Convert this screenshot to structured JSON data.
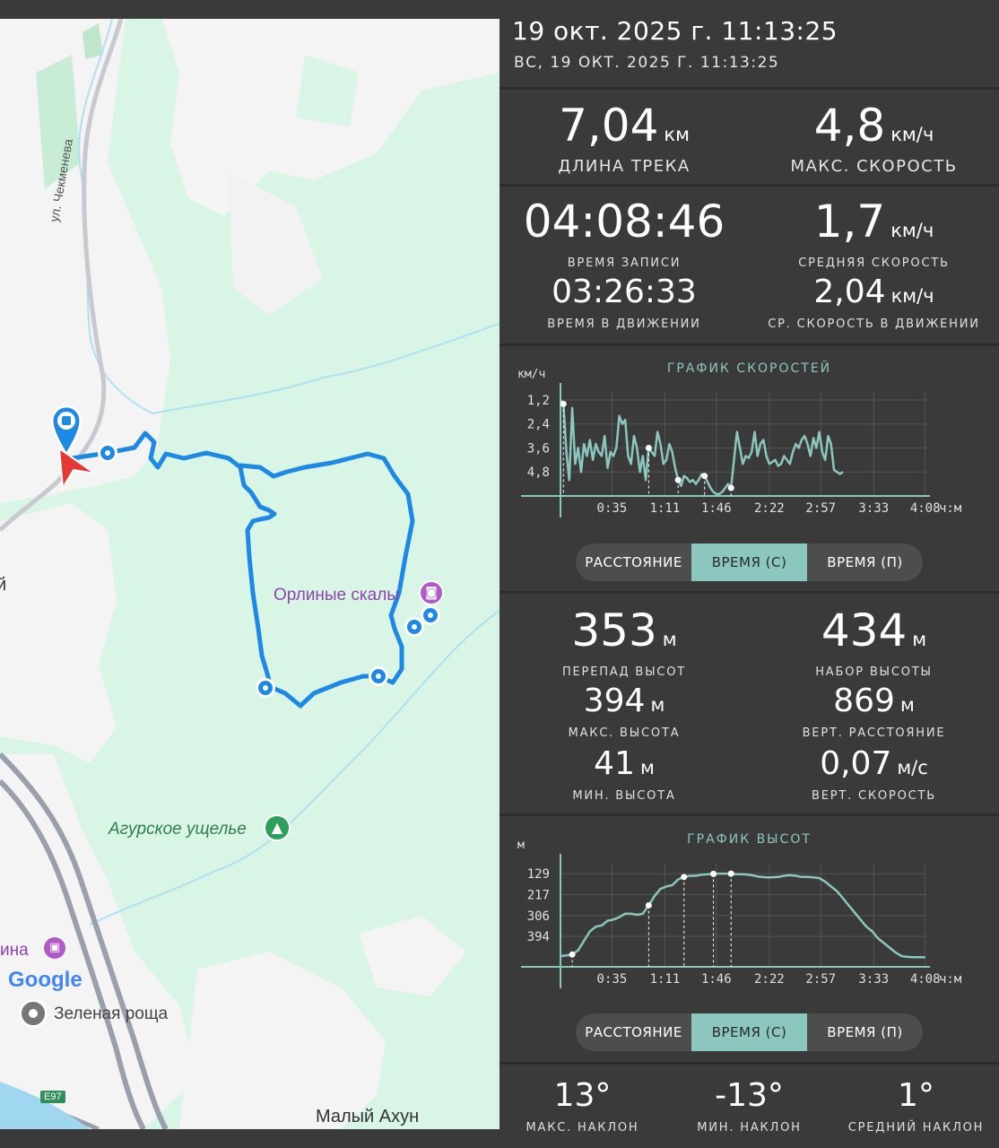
{
  "map": {
    "street_label": "ул. Чекменева",
    "poi_eagle_rocks": "Орлиные скалы",
    "poi_agur_gorge": "Агурское ущелье",
    "poi_partial": "ина",
    "left_edge_char": "й",
    "google_logo": "Google",
    "place_green_grove": "Зеленая роща",
    "place_maly_akhun": "Малый Ахун",
    "road_badge": "E97",
    "icons": [
      "start-pin-icon",
      "direction-arrow-icon",
      "waypoint-icon",
      "camera-poi-icon",
      "tree-poi-icon",
      "building-poi-icon"
    ]
  },
  "header": {
    "title": "19 окт. 2025 г. 11:13:25",
    "subtitle": "ВС, 19 ОКТ. 2025 Г. 11:13:25"
  },
  "summary": {
    "track_length": {
      "value": "7,04",
      "unit": "км",
      "label": "ДЛИНА ТРЕКА"
    },
    "max_speed": {
      "value": "4,8",
      "unit": "км/ч",
      "label": "МАКС. СКОРОСТЬ"
    },
    "record_time": {
      "value": "04:08:46",
      "label": "ВРЕМЯ ЗАПИСИ"
    },
    "avg_speed": {
      "value": "1,7",
      "unit": "км/ч",
      "label": "СРЕДНЯЯ СКОРОСТЬ"
    },
    "moving_time": {
      "value": "03:26:33",
      "label": "ВРЕМЯ В ДВИЖЕНИИ"
    },
    "avg_moving_speed": {
      "value": "2,04",
      "unit": "км/ч",
      "label": "СР. СКОРОСТЬ В ДВИЖЕНИИ"
    }
  },
  "speed_chart": {
    "title": "ГРАФИК СКОРОСТЕЙ",
    "y_unit": "км/ч",
    "x_unit": "ч:м",
    "y_ticks": [
      "4,8",
      "3,6",
      "2,4",
      "1,2"
    ],
    "x_ticks": [
      "0:35",
      "1:11",
      "1:46",
      "2:22",
      "2:57",
      "3:33",
      "4:08"
    ]
  },
  "altitude_chart": {
    "title": "ГРАФИК ВЫСОТ",
    "y_unit": "м",
    "x_unit": "ч:м",
    "y_ticks": [
      "394",
      "306",
      "217",
      "129"
    ],
    "x_ticks": [
      "0:35",
      "1:11",
      "1:46",
      "2:22",
      "2:57",
      "3:33",
      "4:08"
    ]
  },
  "segmented": {
    "distance": "РАССТОЯНИЕ",
    "time_c": "ВРЕМЯ (С)",
    "time_p": "ВРЕМЯ (П)",
    "selected": "ВРЕМЯ (С)"
  },
  "elevation": {
    "elev_diff": {
      "value": "353",
      "unit": "м",
      "label": "ПЕРЕПАД ВЫСОТ"
    },
    "elev_gain": {
      "value": "434",
      "unit": "м",
      "label": "НАБОР ВЫСОТЫ"
    },
    "max_elev": {
      "value": "394",
      "unit": "м",
      "label": "МАКС. ВЫСОТА"
    },
    "vert_dist": {
      "value": "869",
      "unit": "м",
      "label": "ВЕРТ. РАССТОЯНИЕ"
    },
    "min_elev": {
      "value": "41",
      "unit": "м",
      "label": "МИН. ВЫСОТА"
    },
    "vert_speed": {
      "value": "0,07",
      "unit": "м/с",
      "label": "ВЕРТ. СКОРОСТЬ"
    }
  },
  "slope": {
    "max": {
      "value": "13°",
      "label": "МАКС. НАКЛОН"
    },
    "min": {
      "value": "-13°",
      "label": "МИН. НАКЛОН"
    },
    "avg": {
      "value": "1°",
      "label": "СРЕДНИЙ НАКЛОН"
    }
  },
  "chart_data": [
    {
      "type": "line",
      "title": "ГРАФИК СКОРОСТЕЙ",
      "ylabel": "км/ч",
      "xlabel": "ч:м",
      "x_unit": "minutes",
      "ylim": [
        0,
        5.2
      ],
      "xlim": [
        0,
        248.8
      ],
      "x": [
        0,
        2,
        4,
        6,
        8,
        10,
        12,
        14,
        16,
        18,
        20,
        22,
        24,
        26,
        28,
        30,
        32,
        34,
        36,
        38,
        40,
        42,
        44,
        46,
        48,
        50,
        52,
        54,
        56,
        58,
        60,
        62,
        64,
        66,
        68,
        70,
        72,
        74,
        76,
        78,
        80,
        82,
        84,
        86,
        88,
        90,
        92,
        94,
        96,
        98,
        100,
        102,
        104,
        106,
        108,
        110,
        112,
        114,
        116,
        118,
        120,
        122,
        124,
        126,
        128,
        130,
        132,
        134,
        136,
        138,
        140,
        142,
        144,
        146,
        148,
        150,
        152,
        154,
        156,
        158,
        160,
        162,
        164,
        166,
        168,
        170,
        172,
        174,
        176,
        178,
        180,
        182,
        184,
        186,
        188,
        190,
        192,
        194,
        196,
        198,
        200,
        202,
        204,
        206,
        208,
        210,
        212,
        214,
        216,
        218,
        220,
        222,
        224,
        226,
        228,
        230,
        232,
        234,
        236,
        238,
        240,
        242,
        244,
        246,
        248
      ],
      "y": [
        4.8,
        4.6,
        2.2,
        0.8,
        4.4,
        1.6,
        2.4,
        1.2,
        2.6,
        2.0,
        2.8,
        1.8,
        2.6,
        2.2,
        2.0,
        3.0,
        1.4,
        2.2,
        2.0,
        2.4,
        4.0,
        3.6,
        3.8,
        2.0,
        1.6,
        3.0,
        2.4,
        1.2,
        2.0,
        0.8,
        2.4,
        2.2,
        2.0,
        3.2,
        2.6,
        1.6,
        1.8,
        2.6,
        2.2,
        1.4,
        0.8,
        0.5,
        1.0,
        0.9,
        0.7,
        0.8,
        0.6,
        0.8,
        1.1,
        1.0,
        0.7,
        0.4,
        0.2,
        0.1,
        0.1,
        0.2,
        0.4,
        0.6,
        0.4,
        1.8,
        3.2,
        2.4,
        1.6,
        2.0,
        1.9,
        2.2,
        3.2,
        2.0,
        2.6,
        2.8,
        2.0,
        1.6,
        1.7,
        1.8,
        1.5,
        1.6,
        2.0,
        1.8,
        1.6,
        2.2,
        2.6,
        2.4,
        2.8,
        3.0,
        2.6,
        2.0,
        2.9,
        2.4,
        3.2,
        2.2,
        1.8,
        3.0,
        2.6,
        1.3,
        1.2,
        1.1,
        1.2
      ],
      "markers_x": [
        2,
        60,
        80,
        98,
        116
      ],
      "y_ticks": [
        1.2,
        2.4,
        3.6,
        4.8
      ],
      "x_ticks": [
        "0:35",
        "1:11",
        "1:46",
        "2:22",
        "2:57",
        "3:33",
        "4:08"
      ]
    },
    {
      "type": "line",
      "title": "ГРАФИК ВЫСОТ",
      "ylabel": "м",
      "xlabel": "ч:м",
      "x_unit": "minutes",
      "ylim": [
        0,
        440
      ],
      "xlim": [
        0,
        248.8
      ],
      "x": [
        0,
        4,
        8,
        12,
        16,
        20,
        24,
        28,
        32,
        36,
        40,
        44,
        48,
        52,
        56,
        60,
        64,
        68,
        72,
        76,
        80,
        84,
        88,
        92,
        96,
        100,
        104,
        108,
        112,
        116,
        120,
        124,
        128,
        132,
        136,
        140,
        144,
        148,
        152,
        156,
        160,
        164,
        168,
        172,
        176,
        180,
        184,
        188,
        192,
        196,
        200,
        204,
        208,
        212,
        216,
        220,
        224,
        228,
        232,
        236,
        240,
        244,
        248
      ],
      "y": [
        45,
        48,
        52,
        70,
        110,
        150,
        170,
        175,
        195,
        200,
        210,
        225,
        225,
        220,
        225,
        260,
        300,
        330,
        340,
        345,
        370,
        380,
        385,
        385,
        390,
        392,
        393,
        394,
        394,
        394,
        392,
        392,
        390,
        385,
        380,
        378,
        378,
        380,
        385,
        388,
        385,
        380,
        380,
        378,
        375,
        360,
        340,
        320,
        290,
        260,
        230,
        200,
        170,
        150,
        120,
        100,
        80,
        60,
        45,
        42,
        41,
        41,
        41
      ],
      "markers_x": [
        8,
        60,
        84,
        104,
        116
      ],
      "y_ticks": [
        129,
        217,
        306,
        394
      ],
      "x_ticks": [
        "0:35",
        "1:11",
        "1:46",
        "2:22",
        "2:57",
        "3:33",
        "4:08"
      ]
    }
  ]
}
